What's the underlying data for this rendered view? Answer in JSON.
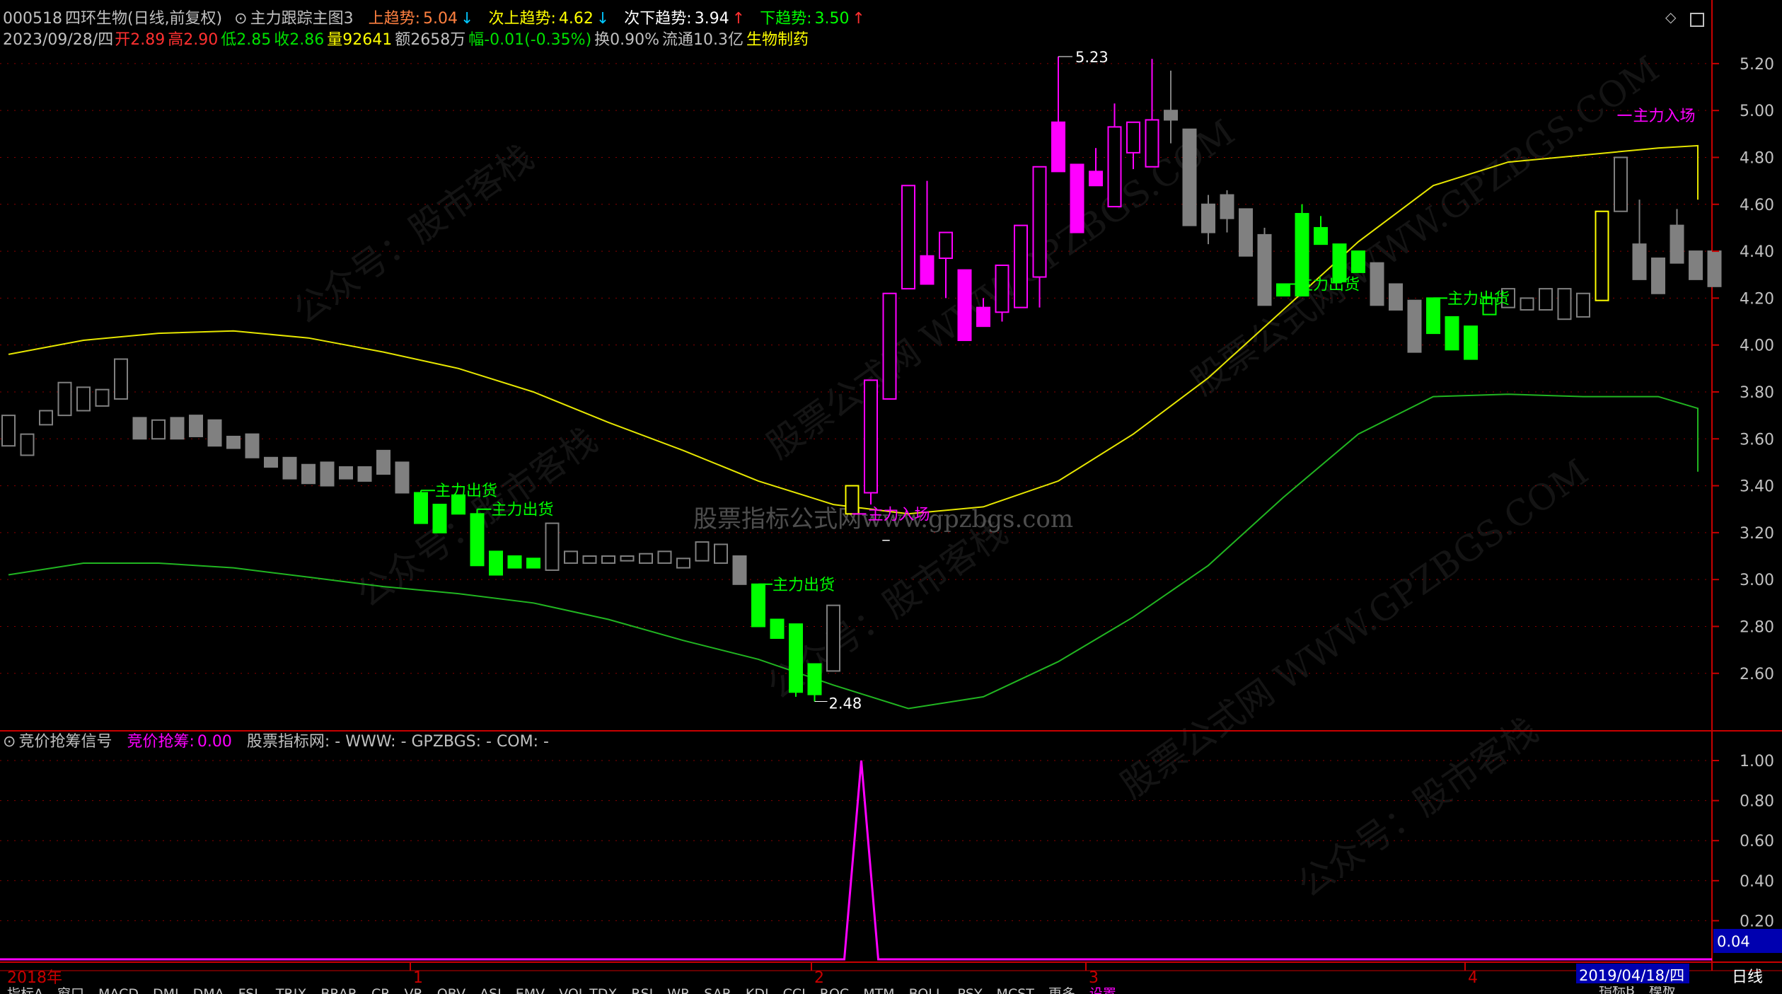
{
  "header": {
    "code": "000518",
    "name": "四环生物(日线,前复权)",
    "indicator": "主力跟踪主图3",
    "up_trend_label": "上趋势:",
    "up_trend_value": "5.04",
    "next_up_label": "次上趋势:",
    "next_up_value": "4.62",
    "next_down_label": "次下趋势:",
    "next_down_value": "3.94",
    "down_trend_label": "下趋势:",
    "down_trend_value": "3.50",
    "arrow_down": "↓",
    "arrow_up": "↑"
  },
  "quote": {
    "date": "2023/09/28/四",
    "open_label": "开",
    "open": "2.89",
    "high_label": "高",
    "high": "2.90",
    "low_label": "低",
    "low": "2.85",
    "close_label": "收",
    "close": "2.86",
    "vol_label": "量",
    "vol": "92641",
    "amount": "额2658万",
    "change": "幅-0.01(-0.35%)",
    "turnover": "换0.90%",
    "float_cap": "流通10.3亿",
    "sector": "生物制药"
  },
  "sub_header": {
    "title": "竞价抢筹信号",
    "signal_label": "竞价抢筹:",
    "signal_value": "0.00",
    "extra": "股票指标网: -   WWW: -   GPZBGS: -   COM: -"
  },
  "colors": {
    "up": "#ff00ff",
    "down": "#00ff00",
    "neutral": "#808080",
    "signal": "#ffff00",
    "upper_band": "#e6e600",
    "lower_band": "#21b521",
    "axis": "#c80000",
    "text_gray": "#c0c0c0"
  },
  "main_axis": {
    "ticks": [
      "5.20",
      "5.00",
      "4.80",
      "4.60",
      "4.40",
      "4.20",
      "4.00",
      "3.80",
      "3.60",
      "3.40",
      "3.20",
      "3.00",
      "2.80",
      "2.60"
    ],
    "ylim": [
      2.48,
      5.23
    ]
  },
  "sub_axis": {
    "ticks": [
      "1.00",
      "0.80",
      "0.60",
      "0.40",
      "0.20"
    ],
    "current_value": "0.04"
  },
  "time_axis": {
    "year_label": "2018年",
    "month_labels": [
      "1",
      "2",
      "3",
      "4"
    ],
    "cursor_date": "2019/04/18/四",
    "period": "日线"
  },
  "annotations": {
    "max_label": "5.23",
    "min_label": "2.48",
    "dash_mark": "_",
    "enter_label": "主力入场",
    "exit_label": "主力出货"
  },
  "watermark": {
    "text1": "公众号：股市客栈",
    "text2": "股票公式网 WWW.GPZBGS.COM",
    "text3": "股票指标公式网www.gpzbgs.com"
  },
  "bottom_tabs": [
    "指标A",
    "窗口",
    "MACD",
    "DMI",
    "DMA",
    "FSL",
    "TRIX",
    "BRAR",
    "CR",
    "VR",
    "OBV",
    "ASI",
    "EMV",
    "VOL-TDX",
    "RSI",
    "WR",
    "SAR",
    "KDJ",
    "CCI",
    "ROC",
    "MTM",
    "BOLL",
    "PSY",
    "MCST",
    "更多",
    "设置"
  ],
  "bottom_right_tabs": [
    "指标B",
    "模板"
  ],
  "chart_data": {
    "type": "candlestick",
    "candles": [
      {
        "o": 3.57,
        "c": 3.7,
        "h": 3.7,
        "l": 3.57
      },
      {
        "o": 3.53,
        "c": 3.62,
        "h": 3.62,
        "l": 3.53
      },
      {
        "o": 3.66,
        "c": 3.72,
        "h": 3.72,
        "l": 3.66
      },
      {
        "o": 3.7,
        "c": 3.84,
        "h": 3.84,
        "l": 3.7
      },
      {
        "o": 3.72,
        "c": 3.82,
        "h": 3.82,
        "l": 3.72
      },
      {
        "o": 3.74,
        "c": 3.81,
        "h": 3.81,
        "l": 3.74
      },
      {
        "o": 3.77,
        "c": 3.94,
        "h": 3.94,
        "l": 3.77
      },
      {
        "o": 3.69,
        "c": 3.6,
        "h": 3.69,
        "l": 3.6
      },
      {
        "o": 3.6,
        "c": 3.68,
        "h": 3.68,
        "l": 3.6
      },
      {
        "o": 3.69,
        "c": 3.6,
        "h": 3.69,
        "l": 3.6
      },
      {
        "o": 3.7,
        "c": 3.61,
        "h": 3.7,
        "l": 3.61
      },
      {
        "o": 3.68,
        "c": 3.57,
        "h": 3.68,
        "l": 3.57
      },
      {
        "o": 3.61,
        "c": 3.56,
        "h": 3.61,
        "l": 3.56
      },
      {
        "o": 3.62,
        "c": 3.52,
        "h": 3.62,
        "l": 3.52
      },
      {
        "o": 3.52,
        "c": 3.48,
        "h": 3.52,
        "l": 3.48
      },
      {
        "o": 3.52,
        "c": 3.43,
        "h": 3.52,
        "l": 3.43
      },
      {
        "o": 3.49,
        "c": 3.41,
        "h": 3.49,
        "l": 3.41
      },
      {
        "o": 3.5,
        "c": 3.4,
        "h": 3.5,
        "l": 3.4
      },
      {
        "o": 3.48,
        "c": 3.43,
        "h": 3.48,
        "l": 3.43
      },
      {
        "o": 3.48,
        "c": 3.42,
        "h": 3.48,
        "l": 3.42
      },
      {
        "o": 3.55,
        "c": 3.45,
        "h": 3.55,
        "l": 3.45
      },
      {
        "o": 3.5,
        "c": 3.37,
        "h": 3.5,
        "l": 3.37
      },
      {
        "o": 3.37,
        "c": 3.24,
        "h": 3.38,
        "l": 3.24
      },
      {
        "o": 3.32,
        "c": 3.2,
        "h": 3.32,
        "l": 3.2
      },
      {
        "o": 3.36,
        "c": 3.28,
        "h": 3.36,
        "l": 3.28
      },
      {
        "o": 3.28,
        "c": 3.06,
        "h": 3.3,
        "l": 3.06
      },
      {
        "o": 3.12,
        "c": 3.02,
        "h": 3.12,
        "l": 3.02
      },
      {
        "o": 3.1,
        "c": 3.05,
        "h": 3.1,
        "l": 3.05
      },
      {
        "o": 3.09,
        "c": 3.05,
        "h": 3.09,
        "l": 3.05
      },
      {
        "o": 3.04,
        "c": 3.24,
        "h": 3.24,
        "l": 3.04
      },
      {
        "o": 3.07,
        "c": 3.12,
        "h": 3.12,
        "l": 3.07
      },
      {
        "o": 3.07,
        "c": 3.1,
        "h": 3.1,
        "l": 3.07
      },
      {
        "o": 3.07,
        "c": 3.1,
        "h": 3.1,
        "l": 3.07
      },
      {
        "o": 3.08,
        "c": 3.1,
        "h": 3.1,
        "l": 3.08
      },
      {
        "o": 3.07,
        "c": 3.11,
        "h": 3.11,
        "l": 3.07
      },
      {
        "o": 3.07,
        "c": 3.12,
        "h": 3.12,
        "l": 3.07
      },
      {
        "o": 3.05,
        "c": 3.09,
        "h": 3.09,
        "l": 3.05
      },
      {
        "o": 3.08,
        "c": 3.16,
        "h": 3.16,
        "l": 3.08
      },
      {
        "o": 3.07,
        "c": 3.15,
        "h": 3.15,
        "l": 3.07
      },
      {
        "o": 3.1,
        "c": 2.98,
        "h": 3.1,
        "l": 2.98
      },
      {
        "o": 2.98,
        "c": 2.8,
        "h": 2.98,
        "l": 2.8
      },
      {
        "o": 2.83,
        "c": 2.75,
        "h": 2.83,
        "l": 2.75
      },
      {
        "o": 2.81,
        "c": 2.52,
        "h": 2.81,
        "l": 2.5
      },
      {
        "o": 2.64,
        "c": 2.51,
        "h": 2.64,
        "l": 2.48
      },
      {
        "o": 2.61,
        "c": 2.89,
        "h": 2.89,
        "l": 2.61
      },
      {
        "o": 3.28,
        "c": 3.4,
        "h": 3.4,
        "l": 3.28
      },
      {
        "o": 3.37,
        "c": 3.85,
        "h": 3.85,
        "l": 3.32
      },
      {
        "o": 3.77,
        "c": 4.22,
        "h": 4.22,
        "l": 3.77
      },
      {
        "o": 4.24,
        "c": 4.68,
        "h": 4.68,
        "l": 4.24
      },
      {
        "o": 4.38,
        "c": 4.26,
        "h": 4.7,
        "l": 4.26
      },
      {
        "o": 4.37,
        "c": 4.48,
        "h": 4.48,
        "l": 4.2
      },
      {
        "o": 4.32,
        "c": 4.02,
        "h": 4.32,
        "l": 4.02
      },
      {
        "o": 4.16,
        "c": 4.08,
        "h": 4.2,
        "l": 4.08
      },
      {
        "o": 4.14,
        "c": 4.34,
        "h": 4.34,
        "l": 4.1
      },
      {
        "o": 4.16,
        "c": 4.51,
        "h": 4.51,
        "l": 4.16
      },
      {
        "o": 4.29,
        "c": 4.76,
        "h": 4.76,
        "l": 4.16
      },
      {
        "o": 4.95,
        "c": 4.74,
        "h": 5.23,
        "l": 4.74
      },
      {
        "o": 4.77,
        "c": 4.48,
        "h": 4.77,
        "l": 4.48
      },
      {
        "o": 4.74,
        "c": 4.68,
        "h": 4.84,
        "l": 4.68
      },
      {
        "o": 4.59,
        "c": 4.93,
        "h": 5.03,
        "l": 4.59
      },
      {
        "o": 4.82,
        "c": 4.95,
        "h": 4.95,
        "l": 4.75
      },
      {
        "o": 4.76,
        "c": 4.96,
        "h": 5.22,
        "l": 4.76
      },
      {
        "o": 5.0,
        "c": 4.96,
        "h": 5.17,
        "l": 4.86
      },
      {
        "o": 4.92,
        "c": 4.51,
        "h": 4.92,
        "l": 4.51
      },
      {
        "o": 4.6,
        "c": 4.48,
        "h": 4.64,
        "l": 4.43
      },
      {
        "o": 4.64,
        "c": 4.54,
        "h": 4.66,
        "l": 4.48
      },
      {
        "o": 4.58,
        "c": 4.38,
        "h": 4.58,
        "l": 4.38
      },
      {
        "o": 4.47,
        "c": 4.17,
        "h": 4.5,
        "l": 4.17
      },
      {
        "o": 4.26,
        "c": 4.21,
        "h": 4.26,
        "l": 4.21
      },
      {
        "o": 4.56,
        "c": 4.21,
        "h": 4.6,
        "l": 4.21
      },
      {
        "o": 4.5,
        "c": 4.43,
        "h": 4.55,
        "l": 4.43
      },
      {
        "o": 4.43,
        "c": 4.27,
        "h": 4.43,
        "l": 4.27
      },
      {
        "o": 4.4,
        "c": 4.31,
        "h": 4.4,
        "l": 4.31
      },
      {
        "o": 4.35,
        "c": 4.17,
        "h": 4.35,
        "l": 4.17
      },
      {
        "o": 4.26,
        "c": 4.15,
        "h": 4.26,
        "l": 4.15
      },
      {
        "o": 4.19,
        "c": 3.97,
        "h": 4.19,
        "l": 3.97
      },
      {
        "o": 4.2,
        "c": 4.05,
        "h": 4.2,
        "l": 4.05
      },
      {
        "o": 4.12,
        "c": 3.98,
        "h": 4.12,
        "l": 3.98
      },
      {
        "o": 4.08,
        "c": 3.94,
        "h": 4.08,
        "l": 3.94
      },
      {
        "o": 4.13,
        "c": 4.2,
        "h": 4.2,
        "l": 4.13
      },
      {
        "o": 4.16,
        "c": 4.24,
        "h": 4.24,
        "l": 4.16
      },
      {
        "o": 4.15,
        "c": 4.2,
        "h": 4.2,
        "l": 4.15
      },
      {
        "o": 4.15,
        "c": 4.24,
        "h": 4.24,
        "l": 4.15
      },
      {
        "o": 4.11,
        "c": 4.24,
        "h": 4.24,
        "l": 4.11
      },
      {
        "o": 4.12,
        "c": 4.22,
        "h": 4.22,
        "l": 4.12
      },
      {
        "o": 4.19,
        "c": 4.57,
        "h": 4.57,
        "l": 4.19
      },
      {
        "o": 4.57,
        "c": 4.8,
        "h": 4.8,
        "l": 4.57
      },
      {
        "o": 4.43,
        "c": 4.28,
        "h": 4.62,
        "l": 4.28
      },
      {
        "o": 4.37,
        "c": 4.22,
        "h": 4.37,
        "l": 4.22
      },
      {
        "o": 4.51,
        "c": 4.35,
        "h": 4.58,
        "l": 4.35
      },
      {
        "o": 4.4,
        "c": 4.28,
        "h": 4.4,
        "l": 4.28
      },
      {
        "o": 4.4,
        "c": 4.25,
        "h": 4.4,
        "l": 4.25
      }
    ],
    "upper_band": [
      3.96,
      4.02,
      4.05,
      4.06,
      4.03,
      3.97,
      3.9,
      3.8,
      3.67,
      3.55,
      3.42,
      3.32,
      3.28,
      3.31,
      3.42,
      3.62,
      3.86,
      4.15,
      4.44,
      4.68,
      4.78,
      4.81,
      4.84,
      4.85,
      4.82,
      4.71,
      4.63,
      4.62,
      4.62
    ],
    "lower_band": [
      3.02,
      3.07,
      3.07,
      3.05,
      3.01,
      2.97,
      2.94,
      2.9,
      2.83,
      2.74,
      2.66,
      2.55,
      2.45,
      2.5,
      2.65,
      2.84,
      3.06,
      3.35,
      3.62,
      3.78,
      3.79,
      3.78,
      3.78,
      3.73,
      3.62,
      3.51,
      3.46,
      3.49,
      3.49
    ],
    "band_step": 4,
    "enter_signals": [
      45,
      85
    ],
    "exit_signals": [
      22,
      25,
      40,
      68,
      76
    ],
    "sub_signal_index": 45,
    "sub_signal_value": 1.0
  }
}
